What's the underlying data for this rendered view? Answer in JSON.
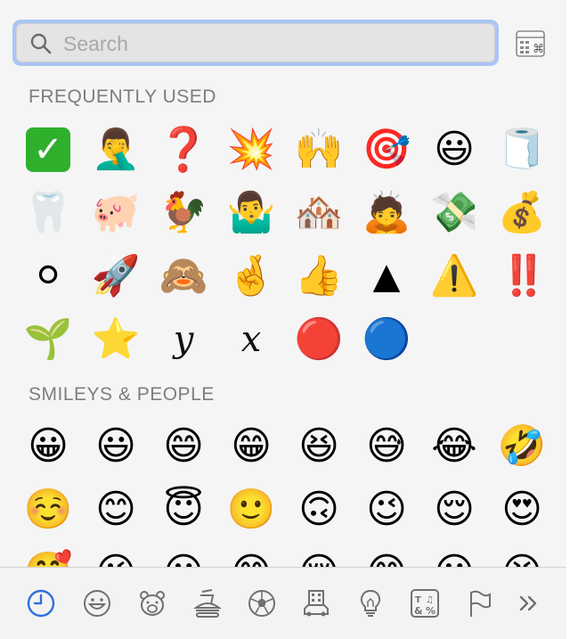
{
  "search": {
    "placeholder": "Search",
    "value": ""
  },
  "sections": {
    "frequently_used": {
      "title": "FREQUENTLY USED",
      "emojis": [
        "✅",
        "🤦‍♂️",
        "❓",
        "💥",
        "🙌",
        "🎯",
        "😃",
        "🧻",
        "🦷",
        "🐖",
        "🐓",
        "🤷‍♂️",
        "🏘️",
        "🙇",
        "💸",
        "💰",
        "⚪",
        "🚀",
        "🙈",
        "🤞",
        "👍",
        "▲",
        "⚠️",
        "‼️",
        "🌱",
        "⭐",
        "𝑦",
        "𝑥",
        "🔴",
        "🔵"
      ]
    },
    "smileys_people": {
      "title": "SMILEYS & PEOPLE",
      "emojis": [
        "😀",
        "😃",
        "😄",
        "😁",
        "😆",
        "😅",
        "😂",
        "🤣",
        "☺️",
        "😊",
        "😇",
        "🙂",
        "🙃",
        "😉",
        "😌",
        "😍",
        "🥰",
        "😘",
        "😗",
        "😙",
        "😚",
        "😋",
        "😛",
        "😝"
      ]
    }
  },
  "categories": [
    {
      "name": "recents",
      "icon": "clock-icon",
      "active": true
    },
    {
      "name": "smileys-people",
      "icon": "smiley-icon",
      "active": false
    },
    {
      "name": "animals-nature",
      "icon": "bear-icon",
      "active": false
    },
    {
      "name": "food-drink",
      "icon": "burger-icon",
      "active": false
    },
    {
      "name": "activity",
      "icon": "soccer-ball-icon",
      "active": false
    },
    {
      "name": "travel-places",
      "icon": "building-car-icon",
      "active": false
    },
    {
      "name": "objects",
      "icon": "lightbulb-icon",
      "active": false
    },
    {
      "name": "symbols",
      "icon": "symbols-icon",
      "active": false
    },
    {
      "name": "flags",
      "icon": "flag-icon",
      "active": false
    },
    {
      "name": "more",
      "icon": "chevrons-right-icon",
      "active": false
    }
  ],
  "colors": {
    "accent": "#2f6fdc",
    "focus_ring": "#a9c6f3",
    "icon_gray": "#707070"
  }
}
